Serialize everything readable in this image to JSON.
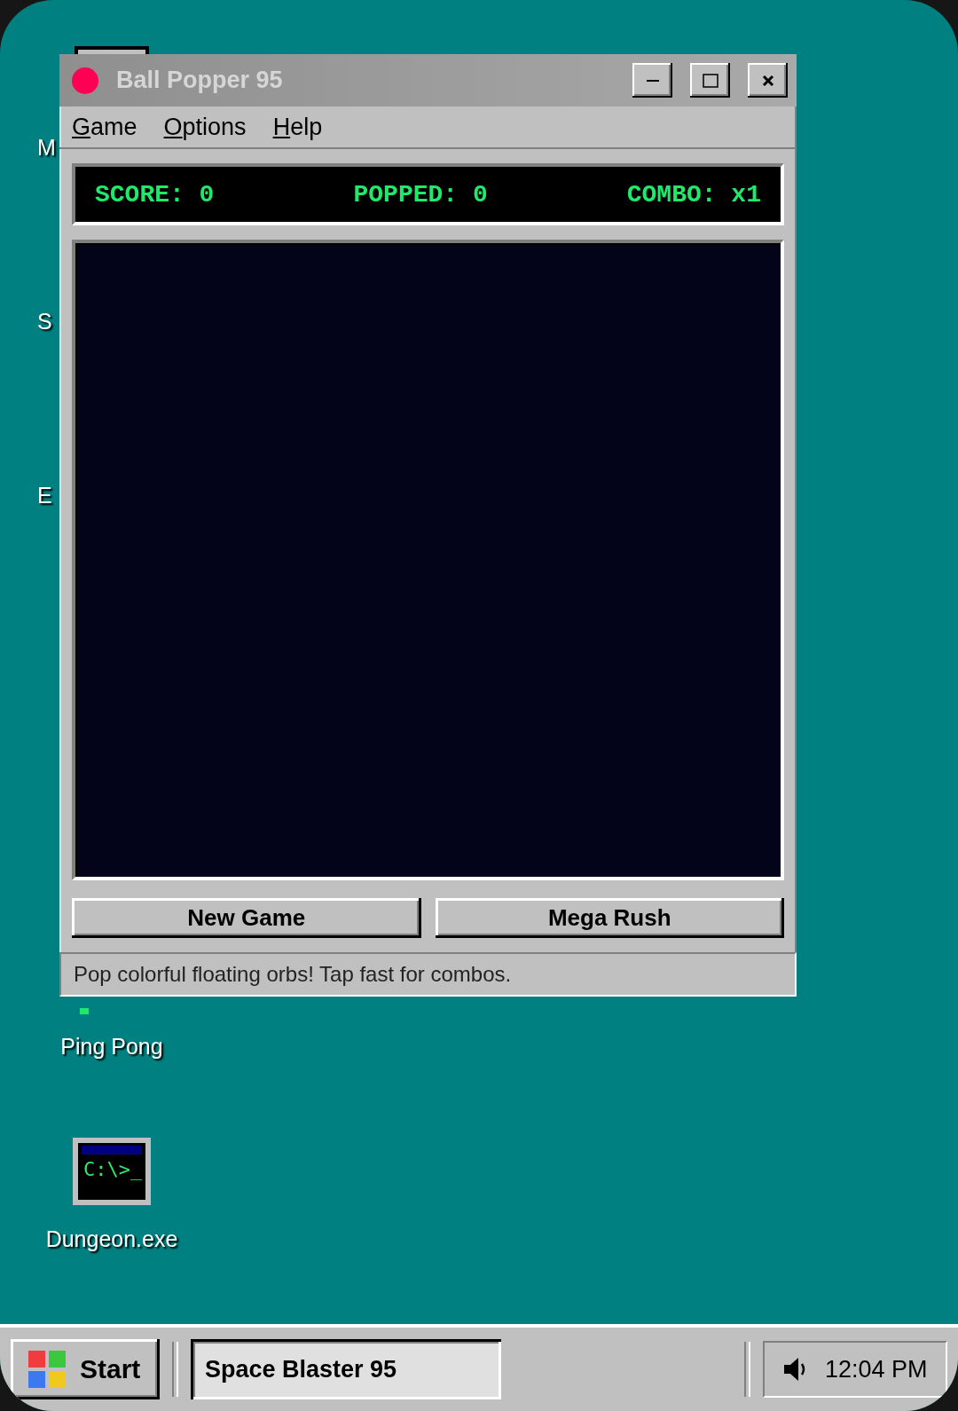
{
  "desktop": {
    "icons": [
      {
        "label": "M",
        "kind": "box"
      },
      {
        "label": "S",
        "kind": "hidden"
      },
      {
        "label": "E",
        "kind": "hidden"
      },
      {
        "label": "Ping Pong",
        "kind": "paddle"
      },
      {
        "label": "Dungeon.exe",
        "kind": "terminal",
        "icon_text": "C:\\>_"
      }
    ]
  },
  "window": {
    "title": "Ball Popper 95",
    "active": false,
    "color": "#ff0055",
    "menu": [
      "Game",
      "Options",
      "Help"
    ],
    "stats": [
      "SCORE: 0",
      "POPPED: 0",
      "COMBO: x1"
    ],
    "buttons": [
      "New Game",
      "Mega Rush"
    ],
    "status": "Pop colorful floating orbs! Tap fast for combos."
  },
  "taskbar": {
    "start": "Start",
    "tasks": [
      {
        "label": "Space Blaster 95",
        "selected": true
      }
    ],
    "clock": "12:04 PM"
  }
}
